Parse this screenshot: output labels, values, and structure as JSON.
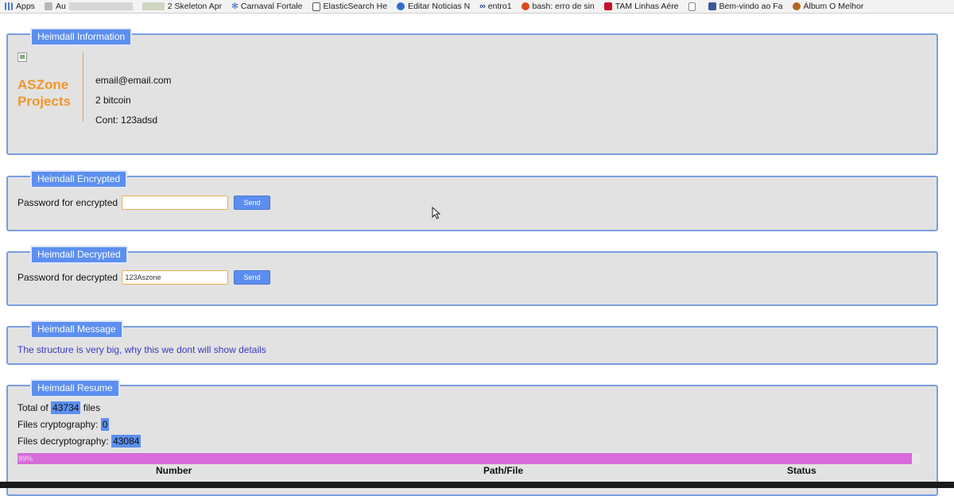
{
  "bookmarks": [
    {
      "label": "Apps",
      "icon": "apps-grid-icon"
    },
    {
      "label": "Au",
      "icon": "page-icon",
      "blurred": true
    },
    {
      "label": "2 Skeleton Apr",
      "icon": "page-icon",
      "blurred_prefix": true
    },
    {
      "label": "Carnaval Fortale",
      "icon": "snowflake-icon"
    },
    {
      "label": "ElasticSearch He",
      "icon": "doc-icon"
    },
    {
      "label": "Editar Noticias N",
      "icon": "ie-icon"
    },
    {
      "label": "entro1",
      "icon": "chain-icon"
    },
    {
      "label": "bash: erro de sin",
      "icon": "ubuntu-icon"
    },
    {
      "label": "TAM Linhas Aére",
      "icon": "tam-icon"
    },
    {
      "label": "",
      "icon": "blank-page-icon"
    },
    {
      "label": "Bem-vindo ao Fa",
      "icon": "facebook-icon"
    },
    {
      "label": "Álbum O Melhor",
      "icon": "album-icon"
    }
  ],
  "info": {
    "legend": "Heimdall Information",
    "logo_line1": "ASZone",
    "logo_line2": "Projects",
    "email": "email@email.com",
    "bitcoin": "2 bitcoin",
    "cont": "Cont: 123adsd"
  },
  "encrypted": {
    "legend": "Heimdall Encrypted",
    "label": "Password for encrypted",
    "value": "",
    "button": "Send"
  },
  "decrypted": {
    "legend": "Heimdall Decrypted",
    "label": "Password for decrypted",
    "value": "123Aszone",
    "button": "Send"
  },
  "message": {
    "legend": "Heimdall Message",
    "text": "The structure is very big, why this we dont will show details"
  },
  "resume": {
    "legend": "Heimdall Resume",
    "total_prefix": "Total of",
    "total_value": "43734",
    "total_suffix": "files",
    "crypt_label": "Files cryptography:",
    "crypt_value": "0",
    "decrypt_label": "Files decryptography:",
    "decrypt_value": "43084",
    "progress_label": "99%",
    "progress_fraction": 0.99,
    "columns": [
      "Number",
      "Path/File",
      "Status"
    ]
  },
  "colors": {
    "panel_border": "#7a9ee0",
    "legend_bg": "#5c8ff0",
    "logo": "#f0962a",
    "message": "#3a3ac0",
    "progress": "#d76bd9"
  }
}
